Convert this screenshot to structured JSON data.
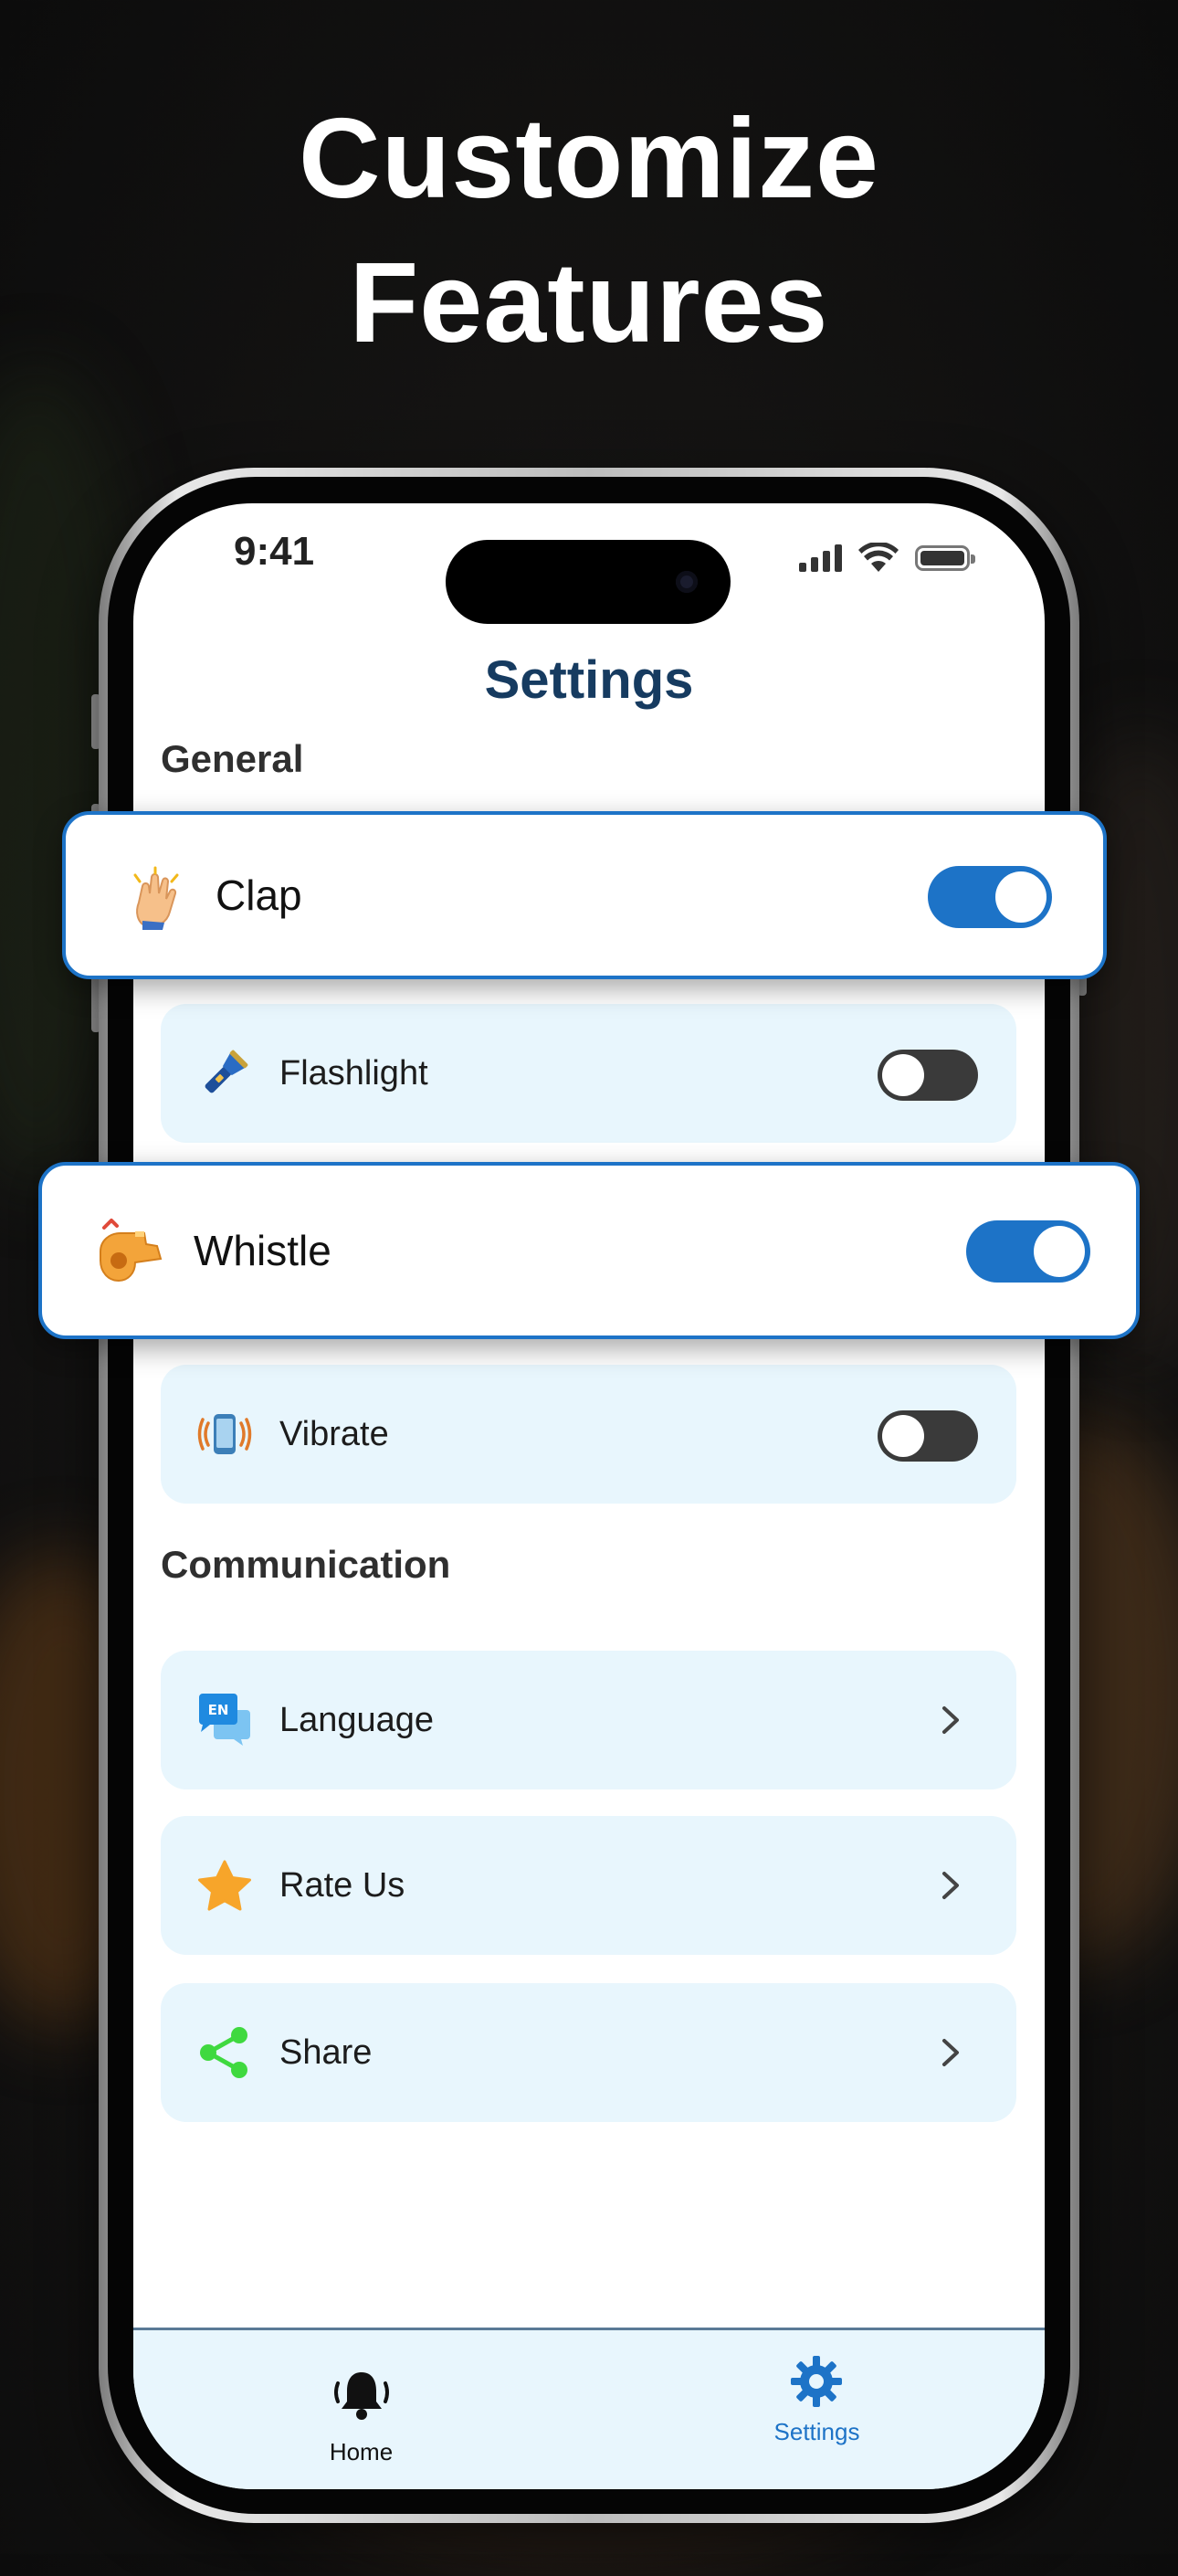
{
  "headline": {
    "line1": "Customize",
    "line2": "Features"
  },
  "status_bar": {
    "time": "9:41",
    "icons": [
      "signal-icon",
      "wifi-icon",
      "battery-icon"
    ]
  },
  "screen_title": "Settings",
  "general": {
    "title": "General",
    "items": [
      {
        "label": "Clap",
        "icon": "clap-icon",
        "enabled": true
      },
      {
        "label": "Flashlight",
        "icon": "flashlight-icon",
        "enabled": false
      },
      {
        "label": "Whistle",
        "icon": "whistle-icon",
        "enabled": true
      },
      {
        "label": "Vibrate",
        "icon": "vibrate-icon",
        "enabled": false
      }
    ]
  },
  "communication": {
    "title": "Communication",
    "items": [
      {
        "label": "Language",
        "icon": "language-icon",
        "badge": "EN"
      },
      {
        "label": "Rate Us",
        "icon": "star-icon"
      },
      {
        "label": "Share",
        "icon": "share-icon"
      }
    ]
  },
  "tab_bar": {
    "tabs": [
      {
        "label": "Home",
        "icon": "bell-icon",
        "active": false
      },
      {
        "label": "Settings",
        "icon": "gear-icon",
        "active": true
      }
    ]
  },
  "colors": {
    "accent": "#1d73c7",
    "title": "#163b60",
    "row_bg": "#e8f6fd",
    "toggle_off": "#3a3a3a"
  }
}
